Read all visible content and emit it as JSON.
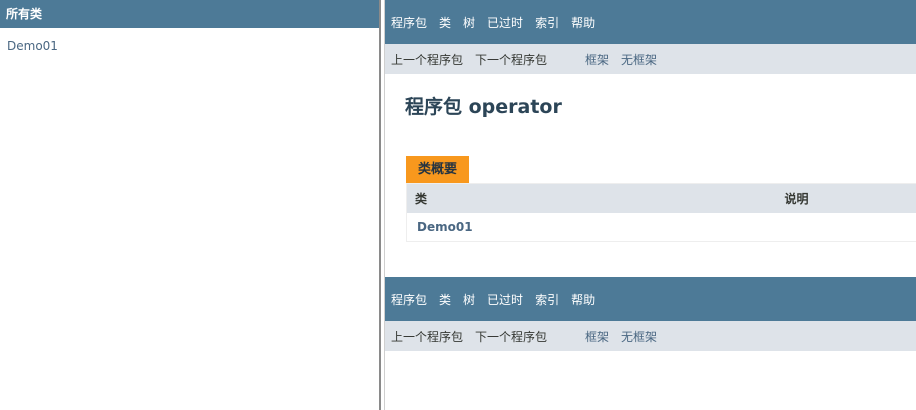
{
  "left_frame": {
    "header": "所有类",
    "items": [
      {
        "label": "Demo01"
      }
    ]
  },
  "top_nav": {
    "items": [
      {
        "label": "程序包"
      },
      {
        "label": "类"
      },
      {
        "label": "树"
      },
      {
        "label": "已过时"
      },
      {
        "label": "索引"
      },
      {
        "label": "帮助"
      }
    ]
  },
  "sub_nav": {
    "prev_package": "上一个程序包",
    "next_package": "下一个程序包",
    "frames": "框架",
    "no_frames": "无框架"
  },
  "page_title": "程序包 operator",
  "class_summary": {
    "tab_label": "类概要",
    "headers": {
      "class": "类",
      "description": "说明"
    },
    "rows": [
      {
        "class": "Demo01",
        "description": ""
      }
    ]
  },
  "colors": {
    "nav_bg": "#4d7a97",
    "subnav_bg": "#dee3e9",
    "tab_bg": "#f8981d",
    "link": "#4a6782"
  }
}
